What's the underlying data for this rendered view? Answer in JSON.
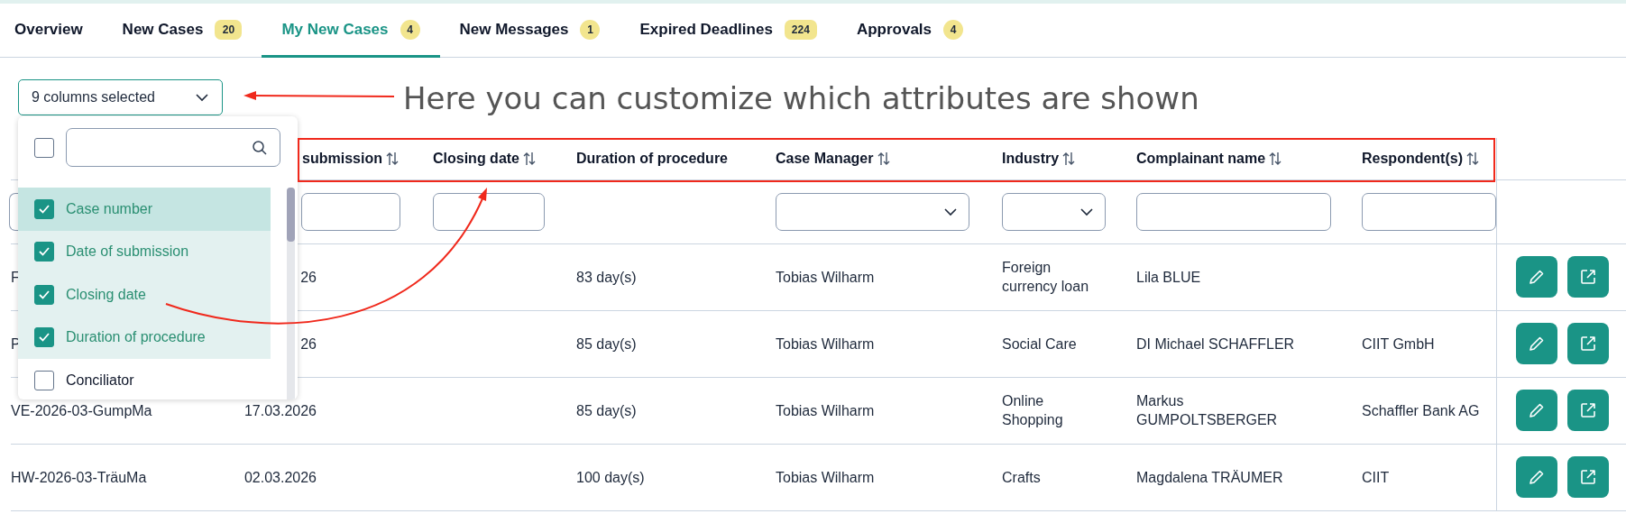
{
  "tabs": [
    {
      "label": "Overview",
      "selected": false
    },
    {
      "label": "New Cases",
      "badge": "20",
      "selected": false
    },
    {
      "label": "My New Cases",
      "badge": "4",
      "selected": true
    },
    {
      "label": "New Messages",
      "badge": "1",
      "selected": false
    },
    {
      "label": "Expired Deadlines",
      "badge": "224",
      "selected": false
    },
    {
      "label": "Approvals",
      "badge": "4",
      "selected": false
    }
  ],
  "column_select": {
    "value": "9 columns selected"
  },
  "annotation": {
    "text": "Here you can customize which attributes are shown"
  },
  "column_menu": {
    "select_all_checked": false,
    "options": [
      {
        "label": "Case number",
        "checked": true,
        "highlighted": true
      },
      {
        "label": "Date of submission",
        "checked": true,
        "highlighted": false
      },
      {
        "label": "Closing date",
        "checked": true,
        "highlighted": false
      },
      {
        "label": "Duration of procedure",
        "checked": true,
        "highlighted": false
      },
      {
        "label": "Conciliator",
        "checked": false,
        "highlighted": false
      }
    ]
  },
  "table": {
    "columns": [
      {
        "filter": {
          "kind": "text"
        }
      },
      {
        "label": "submission",
        "sortable": true,
        "filter": {
          "kind": "text"
        }
      },
      {
        "label": "Closing date",
        "sortable": true,
        "filter": {
          "kind": "text"
        }
      },
      {
        "label": "Duration of procedure",
        "sortable": false
      },
      {
        "label": "Case Manager",
        "sortable": true,
        "filter": {
          "kind": "select"
        }
      },
      {
        "label": "Industry",
        "sortable": true,
        "filter": {
          "kind": "select"
        }
      },
      {
        "label": "Complainant name",
        "sortable": true,
        "filter": {
          "kind": "text"
        }
      },
      {
        "label": "Respondent(s)",
        "sortable": true,
        "filter": {
          "kind": "text"
        }
      }
    ],
    "rows": [
      {
        "cells": [
          "F",
          "26",
          null,
          "83 day(s)",
          "Tobias Wilharm",
          "Foreign currency loan",
          "Lila BLUE",
          null
        ]
      },
      {
        "cells": [
          "P",
          "26",
          null,
          "85 day(s)",
          "Tobias Wilharm",
          "Social Care",
          "DI Michael SCHAFFLER",
          "CIIT GmbH"
        ]
      },
      {
        "cells": [
          "VE-2026-03-GumpMa",
          "17.03.2026",
          null,
          "85 day(s)",
          "Tobias Wilharm",
          "Online Shopping",
          "Markus GUMPOLTSBERGER",
          "Schaffler Bank AG"
        ]
      },
      {
        "cells": [
          "HW-2026-03-TräuMa",
          "02.03.2026",
          null,
          "100 day(s)",
          "Tobias Wilharm",
          "Crafts",
          "Magdalena TRÄUMER",
          "CIIT"
        ]
      }
    ]
  }
}
